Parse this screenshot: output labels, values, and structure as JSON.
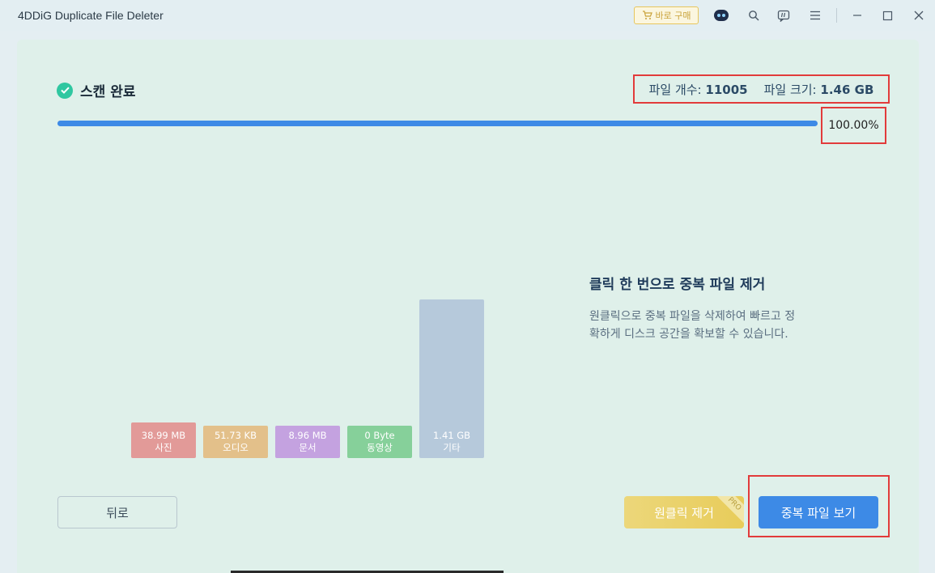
{
  "app": {
    "title": "4DDiG Duplicate File Deleter",
    "buy_label": "바로 구매"
  },
  "titlebar_icons": [
    "robot-icon",
    "search-icon",
    "feedback-icon",
    "menu-icon",
    "minimize-icon",
    "maximize-icon",
    "close-icon"
  ],
  "scan": {
    "status": "스캔 완료",
    "file_count_label": "파일 개수:",
    "file_count": "11005",
    "file_size_label": "파일 크기:",
    "file_size": "1.46 GB",
    "progress_text": "100.00%",
    "progress": 1.0
  },
  "chart_data": {
    "type": "bar",
    "categories": [
      "사진",
      "오디오",
      "문서",
      "동영상",
      "기타"
    ],
    "values": [
      "38.99 MB",
      "51.73 KB",
      "8.96 MB",
      "0 Byte",
      "1.41 GB"
    ],
    "colors": [
      "#e29a98",
      "#e3c08a",
      "#c4a2e0",
      "#86d09a",
      "#b6c9db"
    ]
  },
  "feature": {
    "title": "클릭 한 번으로 중복 파일 제거",
    "desc_line1": "원클릭으로 중복 파일을 삭제하여 빠르고 정",
    "desc_line2": "확하게 디스크 공간을 확보할 수 있습니다."
  },
  "buttons": {
    "back": "뒤로",
    "oneclick": "원클릭 제거",
    "pro": "PRO",
    "view": "중복 파일 보기"
  },
  "colors": {
    "accent": "#3d8ae6",
    "success": "#2fc7a0",
    "highlight": "#e23b3b",
    "gold": "#e8cc5a"
  }
}
